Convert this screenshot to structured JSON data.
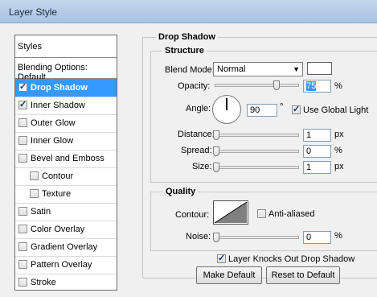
{
  "window": {
    "title": "Layer Style"
  },
  "styles_panel": {
    "header": "Styles",
    "blending_options": "Blending Options: Default",
    "items": [
      {
        "label": "Drop Shadow",
        "checked": true
      },
      {
        "label": "Inner Shadow",
        "checked": true
      },
      {
        "label": "Outer Glow",
        "checked": false
      },
      {
        "label": "Inner Glow",
        "checked": false
      },
      {
        "label": "Bevel and Emboss",
        "checked": false
      },
      {
        "label": "Contour",
        "checked": false
      },
      {
        "label": "Texture",
        "checked": false
      },
      {
        "label": "Satin",
        "checked": false
      },
      {
        "label": "Color Overlay",
        "checked": false
      },
      {
        "label": "Gradient Overlay",
        "checked": false
      },
      {
        "label": "Pattern Overlay",
        "checked": false
      },
      {
        "label": "Stroke",
        "checked": false
      }
    ]
  },
  "drop_shadow": {
    "section_title": "Drop Shadow",
    "structure": {
      "title": "Structure",
      "blend_mode_label": "Blend Mode:",
      "blend_mode_value": "Normal",
      "shadow_color": "#ffffff",
      "opacity_label": "Opacity:",
      "opacity_value": "75",
      "opacity_unit": "%",
      "angle_label": "Angle:",
      "angle_value": "90",
      "angle_unit": "°",
      "use_global_light_label": "Use Global Light",
      "use_global_light_checked": true,
      "distance_label": "Distance:",
      "distance_value": "1",
      "distance_unit": "px",
      "spread_label": "Spread:",
      "spread_value": "0",
      "spread_unit": "%",
      "size_label": "Size:",
      "size_value": "1",
      "size_unit": "px"
    },
    "quality": {
      "title": "Quality",
      "contour_label": "Contour:",
      "anti_aliased_label": "Anti-aliased",
      "anti_aliased_checked": false,
      "noise_label": "Noise:",
      "noise_value": "0",
      "noise_unit": "%"
    },
    "layer_knocks_out_label": "Layer Knocks Out Drop Shadow",
    "layer_knocks_out_checked": true,
    "make_default_label": "Make Default",
    "reset_default_label": "Reset to Default"
  }
}
